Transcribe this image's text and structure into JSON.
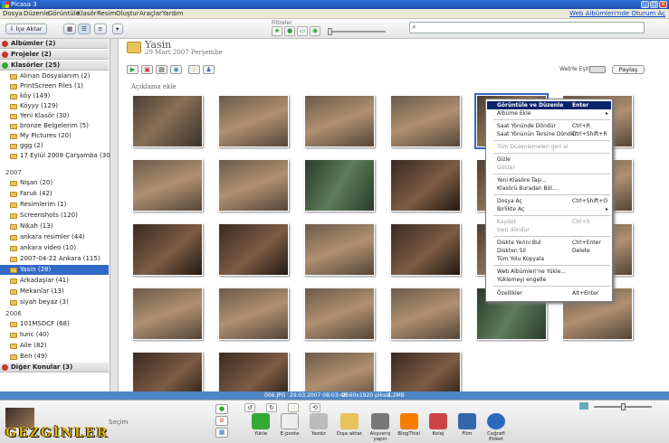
{
  "window": {
    "title": "Picasa 3"
  },
  "menu": {
    "items": [
      "Dosya",
      "Düzenle",
      "Görüntüle",
      "Klasör",
      "Resim",
      "Oluştur",
      "Araçlar",
      "Yardım"
    ],
    "right_link": "Web Albümleri'nde Oturum Aç"
  },
  "toolbar": {
    "import_label": "İçe Aktar",
    "filters_label": "Filtreler",
    "search_placeholder": ""
  },
  "sidebar": {
    "sections": {
      "albums": "Albümler (2)",
      "projects": "Projeler (2)",
      "folders": "Klasörler (25)",
      "other": "Diğer Konular (3)"
    },
    "folders_a": [
      "Alınan Dosyalanım (2)",
      "PrintScreen Files (1)",
      "köy (149)",
      "Köyyy (129)",
      "Yeni Klasör (30)",
      "bronze Belgelerim (5)",
      "My Pictures (20)",
      "ggg (2)",
      "17 Eylül 2008 Çarşamba (305)"
    ],
    "year_2007": "2007",
    "folders_b": [
      "Nişan (20)",
      "Faruk (42)",
      "Resimlerim (1)",
      "Screenshots (120)",
      "Nikah (13)",
      "ankara resimler (44)",
      "ankara video (10)",
      "2007-04-22 Ankara (115)",
      "Yasin (28)",
      "Arkadaşlar (41)",
      "Mekanlar (13)",
      "siyah beyaz (3)"
    ],
    "year_2006": "2006",
    "folders_c": [
      "101MSDCF (68)",
      "tunc (40)",
      "Aile (82)",
      "Ben (49)"
    ]
  },
  "album": {
    "title": "Yasin",
    "date": "29 Mart 2007 Perşembe",
    "caption_placeholder": "Açıklama ekle",
    "web_sync_label": "WebYe Eşitle",
    "share_label": "Paylaş"
  },
  "context_menu": {
    "items": [
      {
        "label": "Görüntüle ve Düzenle",
        "shortcut": "Enter"
      },
      {
        "label": "Albüme Ekle",
        "shortcut": ""
      },
      {
        "label": "Saat Yönünde Döndür",
        "shortcut": "Ctrl+R"
      },
      {
        "label": "Saat Yönünün Tersine Döndür",
        "shortcut": "Ctrl+Shift+R"
      },
      {
        "label": "Tüm Düzenlemeleri geri al",
        "shortcut": ""
      },
      {
        "label": "Gizle",
        "shortcut": ""
      },
      {
        "label": "Göster",
        "shortcut": ""
      },
      {
        "label": "Yeni Klasöre Taşı...",
        "shortcut": ""
      },
      {
        "label": "Klasörü Buradan Böl...",
        "shortcut": ""
      },
      {
        "label": "Dosya Aç",
        "shortcut": "Ctrl+Shift+O"
      },
      {
        "label": "Birlikte Aç",
        "shortcut": ""
      },
      {
        "label": "Kaydet",
        "shortcut": "Ctrl+S"
      },
      {
        "label": "Geri döndür",
        "shortcut": ""
      },
      {
        "label": "Diskte Yerini Bul",
        "shortcut": "Ctrl+Enter"
      },
      {
        "label": "Diskten Sil",
        "shortcut": "Delete"
      },
      {
        "label": "Tüm Yolu Kopyala",
        "shortcut": ""
      },
      {
        "label": "Web Albümleri'ne Yükle...",
        "shortcut": ""
      },
      {
        "label": "Yüklemeyi engelle",
        "shortcut": ""
      },
      {
        "label": "Özellikler",
        "shortcut": "Alt+Enter"
      }
    ]
  },
  "status": {
    "filename": "006.JPG",
    "datetime": "29.03.2007 08:03:48",
    "dimensions": "2560x1920 piksel",
    "size": "1,2MB"
  },
  "tray": {
    "selection_label": "Seçim",
    "watermark": "GEZGİNLER",
    "actions": [
      "Yükle",
      "E-posta",
      "Yazdır",
      "Dışa aktar",
      "Alışveriş yapın",
      "BlogThis!",
      "Kolaj",
      "Film",
      "Coğrafi Etiket"
    ]
  },
  "colors": {
    "selection": "#3169c6",
    "status_bar": "#4f86c6",
    "menu_highlight": "#0a246a"
  }
}
